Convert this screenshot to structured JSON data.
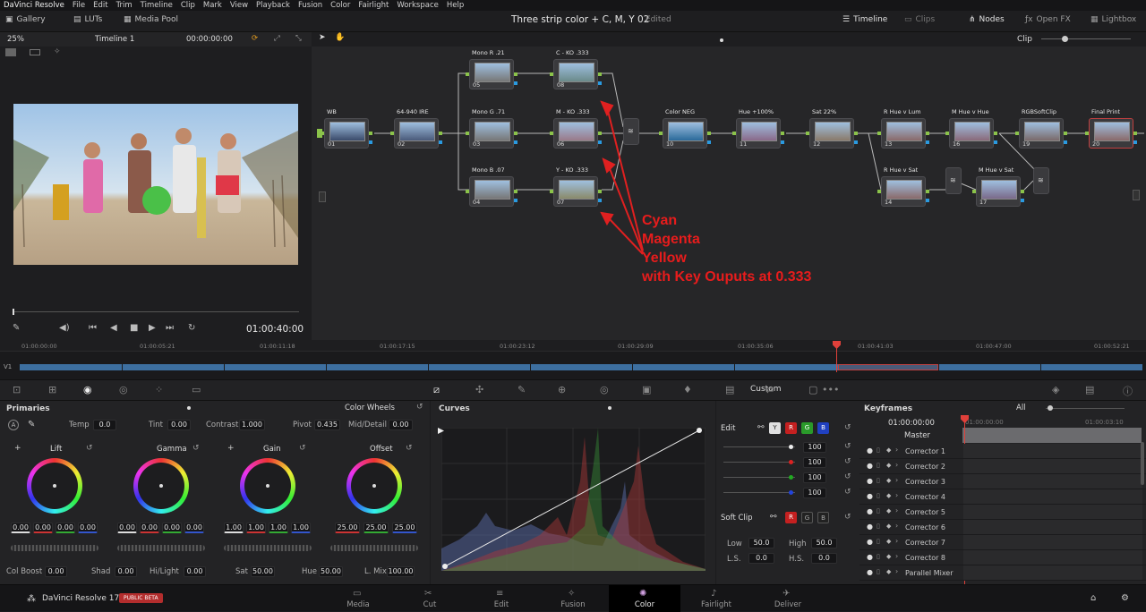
{
  "menu": [
    "DaVinci Resolve",
    "File",
    "Edit",
    "Trim",
    "Timeline",
    "Clip",
    "Mark",
    "View",
    "Playback",
    "Fusion",
    "Color",
    "Fairlight",
    "Workspace",
    "Help"
  ],
  "topbar": {
    "gallery": "Gallery",
    "luts": "LUTs",
    "media_pool": "Media Pool",
    "title": "Three strip color + C, M, Y 02",
    "status": "Edited",
    "timeline": "Timeline",
    "clips": "Clips",
    "nodes": "Nodes",
    "open_fx": "Open FX",
    "lightbox": "Lightbox"
  },
  "viewer": {
    "zoom": "25%",
    "timeline_name": "Timeline 1",
    "timecode_top": "00:00:00:00",
    "timecode": "01:00:40:00"
  },
  "nodebar": {
    "mode": "Clip"
  },
  "nodes": [
    {
      "label": "WB",
      "num": "01"
    },
    {
      "label": "64-940 IRE",
      "num": "02"
    },
    {
      "label": "Mono R .21",
      "num": "05"
    },
    {
      "label": "Mono G .71",
      "num": "03"
    },
    {
      "label": "Mono B .07",
      "num": "04"
    },
    {
      "label": "C - KO .333",
      "num": "08"
    },
    {
      "label": "M - KO .333",
      "num": "06"
    },
    {
      "label": "Y - KO .333",
      "num": "07"
    },
    {
      "label": "Color NEG",
      "num": "10"
    },
    {
      "label": "Hue +100%",
      "num": "11"
    },
    {
      "label": "Sat 22%",
      "num": "12"
    },
    {
      "label": "R Hue v Lum",
      "num": "13"
    },
    {
      "label": "R Hue v Sat",
      "num": "14"
    },
    {
      "label": "M Hue v Hue",
      "num": "16"
    },
    {
      "label": "M Hue v Sat",
      "num": "17"
    },
    {
      "label": "RGBSoftClip",
      "num": "19"
    },
    {
      "label": "Final Print",
      "num": "20"
    }
  ],
  "annotation": [
    "Cyan",
    "Magenta",
    "Yellow",
    "with Key Ouputs at 0.333"
  ],
  "timeline": {
    "ticks": [
      "01:00:00:00",
      "01:00:05:21",
      "01:00:11:18",
      "01:00:17:15",
      "01:00:23:12",
      "01:00:29:09",
      "01:00:35:06",
      "01:00:41:03",
      "01:00:47:00",
      "01:00:52:21"
    ],
    "track": "V1"
  },
  "primaries": {
    "title": "Primaries",
    "mode": "Color Wheels",
    "temp_label": "Temp",
    "temp": "0.0",
    "tint_label": "Tint",
    "tint": "0.00",
    "contrast_label": "Contrast",
    "contrast": "1.000",
    "pivot_label": "Pivot",
    "pivot": "0.435",
    "middetail_label": "Mid/Detail",
    "middetail": "0.00",
    "wheels": [
      {
        "name": "Lift",
        "values": [
          "0.00",
          "0.00",
          "0.00",
          "0.00"
        ]
      },
      {
        "name": "Gamma",
        "values": [
          "0.00",
          "0.00",
          "0.00",
          "0.00"
        ]
      },
      {
        "name": "Gain",
        "values": [
          "1.00",
          "1.00",
          "1.00",
          "1.00"
        ]
      },
      {
        "name": "Offset",
        "values": [
          "25.00",
          "25.00",
          "25.00"
        ]
      }
    ],
    "colboost_label": "Col Boost",
    "colboost": "0.00",
    "shad_label": "Shad",
    "shad": "0.00",
    "hilight_label": "Hi/Light",
    "hilight": "0.00",
    "sat_label": "Sat",
    "sat": "50.00",
    "hue_label": "Hue",
    "hue": "50.00",
    "lmix_label": "L. Mix",
    "lmix": "100.00"
  },
  "curves": {
    "title": "Curves",
    "mode": "Custom",
    "edit_label": "Edit",
    "channels": [
      "Y",
      "R",
      "G",
      "B"
    ],
    "intensity": [
      "100",
      "100",
      "100",
      "100"
    ],
    "softclip_label": "Soft Clip",
    "low_label": "Low",
    "low": "50.0",
    "high_label": "High",
    "high": "50.0",
    "ls_label": "L.S.",
    "ls": "0.0",
    "hs_label": "H.S.",
    "hs": "0.0"
  },
  "keyframes": {
    "title": "Keyframes",
    "filter": "All",
    "timecode": "01:00:00:00",
    "tc_a": "01:00:00:00",
    "tc_b": "01:00:03:10",
    "master": "Master",
    "rows": [
      "Corrector 1",
      "Corrector 2",
      "Corrector 3",
      "Corrector 4",
      "Corrector 5",
      "Corrector 6",
      "Corrector 7",
      "Corrector 8",
      "Parallel Mixer"
    ]
  },
  "bottom": {
    "app": "DaVinci Resolve 17",
    "badge": "PUBLIC BETA",
    "pages": [
      "Media",
      "Cut",
      "Edit",
      "Fusion",
      "Color",
      "Fairlight",
      "Deliver"
    ],
    "active": "Color"
  }
}
